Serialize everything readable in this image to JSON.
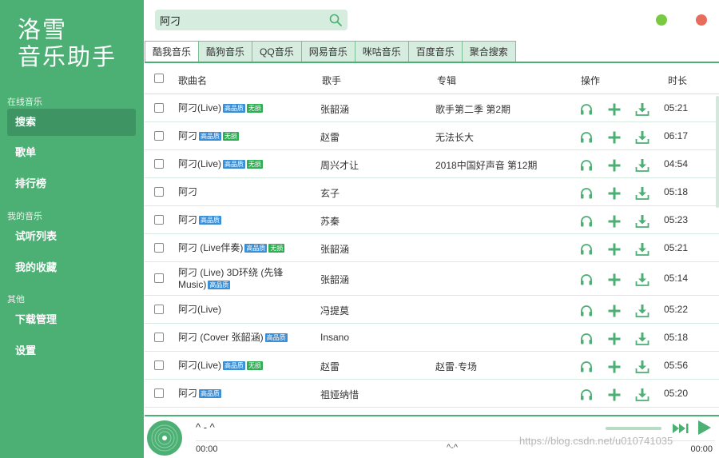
{
  "app": {
    "logo_line1": "洛雪",
    "logo_line2": "音乐助手"
  },
  "colors": {
    "accent": "#4caf73",
    "accent_dark": "#3e9462",
    "minimize": "#7ac943",
    "close": "#e86c5b",
    "badge_hq": "#3b8fd6",
    "badge_lossless": "#2fae54"
  },
  "sidebar": {
    "sections": [
      {
        "title": "在线音乐",
        "items": [
          "搜索",
          "歌单",
          "排行榜"
        ]
      },
      {
        "title": "我的音乐",
        "items": [
          "试听列表",
          "我的收藏"
        ]
      },
      {
        "title": "其他",
        "items": [
          "下载管理",
          "设置"
        ]
      }
    ],
    "active": "搜索"
  },
  "search": {
    "value": "阿刁",
    "icon": "search-icon"
  },
  "tabs": [
    "酷我音乐",
    "酷狗音乐",
    "QQ音乐",
    "网易音乐",
    "咪咕音乐",
    "百度音乐",
    "聚合搜索"
  ],
  "active_tab": "酷我音乐",
  "table": {
    "headers": {
      "song": "歌曲名",
      "artist": "歌手",
      "album": "专辑",
      "actions": "操作",
      "duration": "时长"
    },
    "badges": {
      "hq": "高品质",
      "lossless": "无损"
    },
    "action_icons": [
      "headphones-icon",
      "plus-icon",
      "download-icon"
    ],
    "rows": [
      {
        "name": "阿刁(Live)",
        "hq": true,
        "lossless": true,
        "artist": "张韶涵",
        "album": "歌手第二季 第2期",
        "duration": "05:21"
      },
      {
        "name": "阿刁",
        "hq": true,
        "lossless": true,
        "artist": "赵雷",
        "album": "无法长大",
        "duration": "06:17"
      },
      {
        "name": "阿刁(Live)",
        "hq": true,
        "lossless": true,
        "artist": "周兴才让",
        "album": "2018中国好声音 第12期",
        "duration": "04:54"
      },
      {
        "name": "阿刁",
        "hq": false,
        "lossless": false,
        "artist": "玄子",
        "album": "",
        "duration": "05:18"
      },
      {
        "name": "阿刁",
        "hq": true,
        "lossless": false,
        "artist": "苏秦",
        "album": "",
        "duration": "05:23"
      },
      {
        "name": "阿刁 (Live伴奏)",
        "hq": true,
        "lossless": true,
        "artist": "张韶涵",
        "album": "",
        "duration": "05:21"
      },
      {
        "name": "阿刁 (Live) 3D环绕 (先锋Music)",
        "hq": true,
        "lossless": false,
        "artist": "张韶涵",
        "album": "",
        "duration": "05:14"
      },
      {
        "name": "阿刁(Live)",
        "hq": false,
        "lossless": false,
        "artist": "冯提莫",
        "album": "",
        "duration": "05:22"
      },
      {
        "name": "阿刁 (Cover 张韶涵)",
        "hq": true,
        "lossless": false,
        "artist": "Insano",
        "album": "",
        "duration": "05:18"
      },
      {
        "name": "阿刁(Live)",
        "hq": true,
        "lossless": true,
        "artist": "赵雷",
        "album": "赵雷·专场",
        "duration": "05:56"
      },
      {
        "name": "阿刁",
        "hq": true,
        "lossless": false,
        "artist": "祖娅纳惜",
        "album": "",
        "duration": "05:20"
      }
    ]
  },
  "player": {
    "title": "^ - ^",
    "time_current": "00:00",
    "time_total": "00:00",
    "center_text": "^-^",
    "volume": 1.0,
    "progress": 0.0
  },
  "watermark": "https://blog.csdn.net/u010741035"
}
